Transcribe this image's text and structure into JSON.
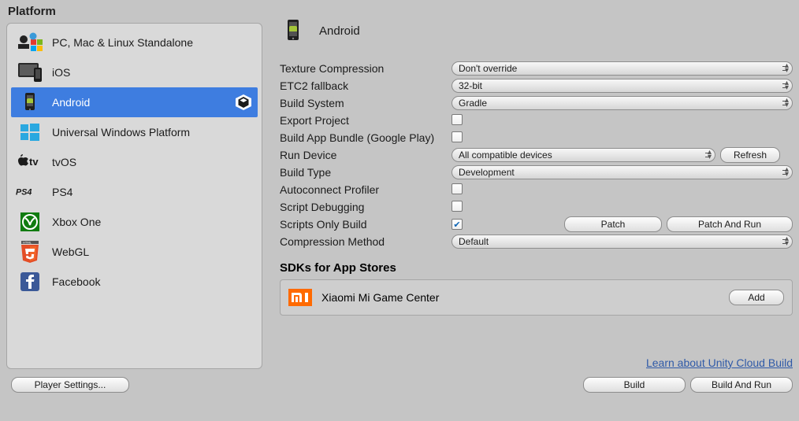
{
  "left": {
    "section_label": "Platform",
    "items": [
      {
        "label": "PC, Mac & Linux Standalone",
        "selected": false
      },
      {
        "label": "iOS",
        "selected": false
      },
      {
        "label": "Android",
        "selected": true
      },
      {
        "label": "Universal Windows Platform",
        "selected": false
      },
      {
        "label": "tvOS",
        "selected": false
      },
      {
        "label": "PS4",
        "selected": false
      },
      {
        "label": "Xbox One",
        "selected": false
      },
      {
        "label": "WebGL",
        "selected": false
      },
      {
        "label": "Facebook",
        "selected": false
      }
    ]
  },
  "right": {
    "header_title": "Android",
    "settings": {
      "texture_compression": {
        "label": "Texture Compression",
        "value": "Don't override"
      },
      "etc2_fallback": {
        "label": "ETC2 fallback",
        "value": "32-bit"
      },
      "build_system": {
        "label": "Build System",
        "value": "Gradle"
      },
      "export_project": {
        "label": "Export Project",
        "checked": false
      },
      "build_app_bundle": {
        "label": "Build App Bundle (Google Play)",
        "checked": false
      },
      "run_device": {
        "label": "Run Device",
        "value": "All compatible devices",
        "refresh_label": "Refresh"
      },
      "build_type": {
        "label": "Build Type",
        "value": "Development"
      },
      "autoconnect_profiler": {
        "label": "Autoconnect Profiler",
        "checked": false
      },
      "script_debugging": {
        "label": "Script Debugging",
        "checked": false
      },
      "scripts_only_build": {
        "label": "Scripts Only Build",
        "checked": true,
        "patch_label": "Patch",
        "patch_and_run_label": "Patch And Run"
      },
      "compression_method": {
        "label": "Compression Method",
        "value": "Default"
      }
    },
    "sdk_section": {
      "title": "SDKs for App Stores",
      "items": [
        {
          "name": "Xiaomi Mi Game Center",
          "button_label": "Add"
        }
      ]
    },
    "cloud_link": "Learn about Unity Cloud Build"
  },
  "bottom": {
    "player_settings": "Player Settings...",
    "build": "Build",
    "build_and_run": "Build And Run"
  }
}
